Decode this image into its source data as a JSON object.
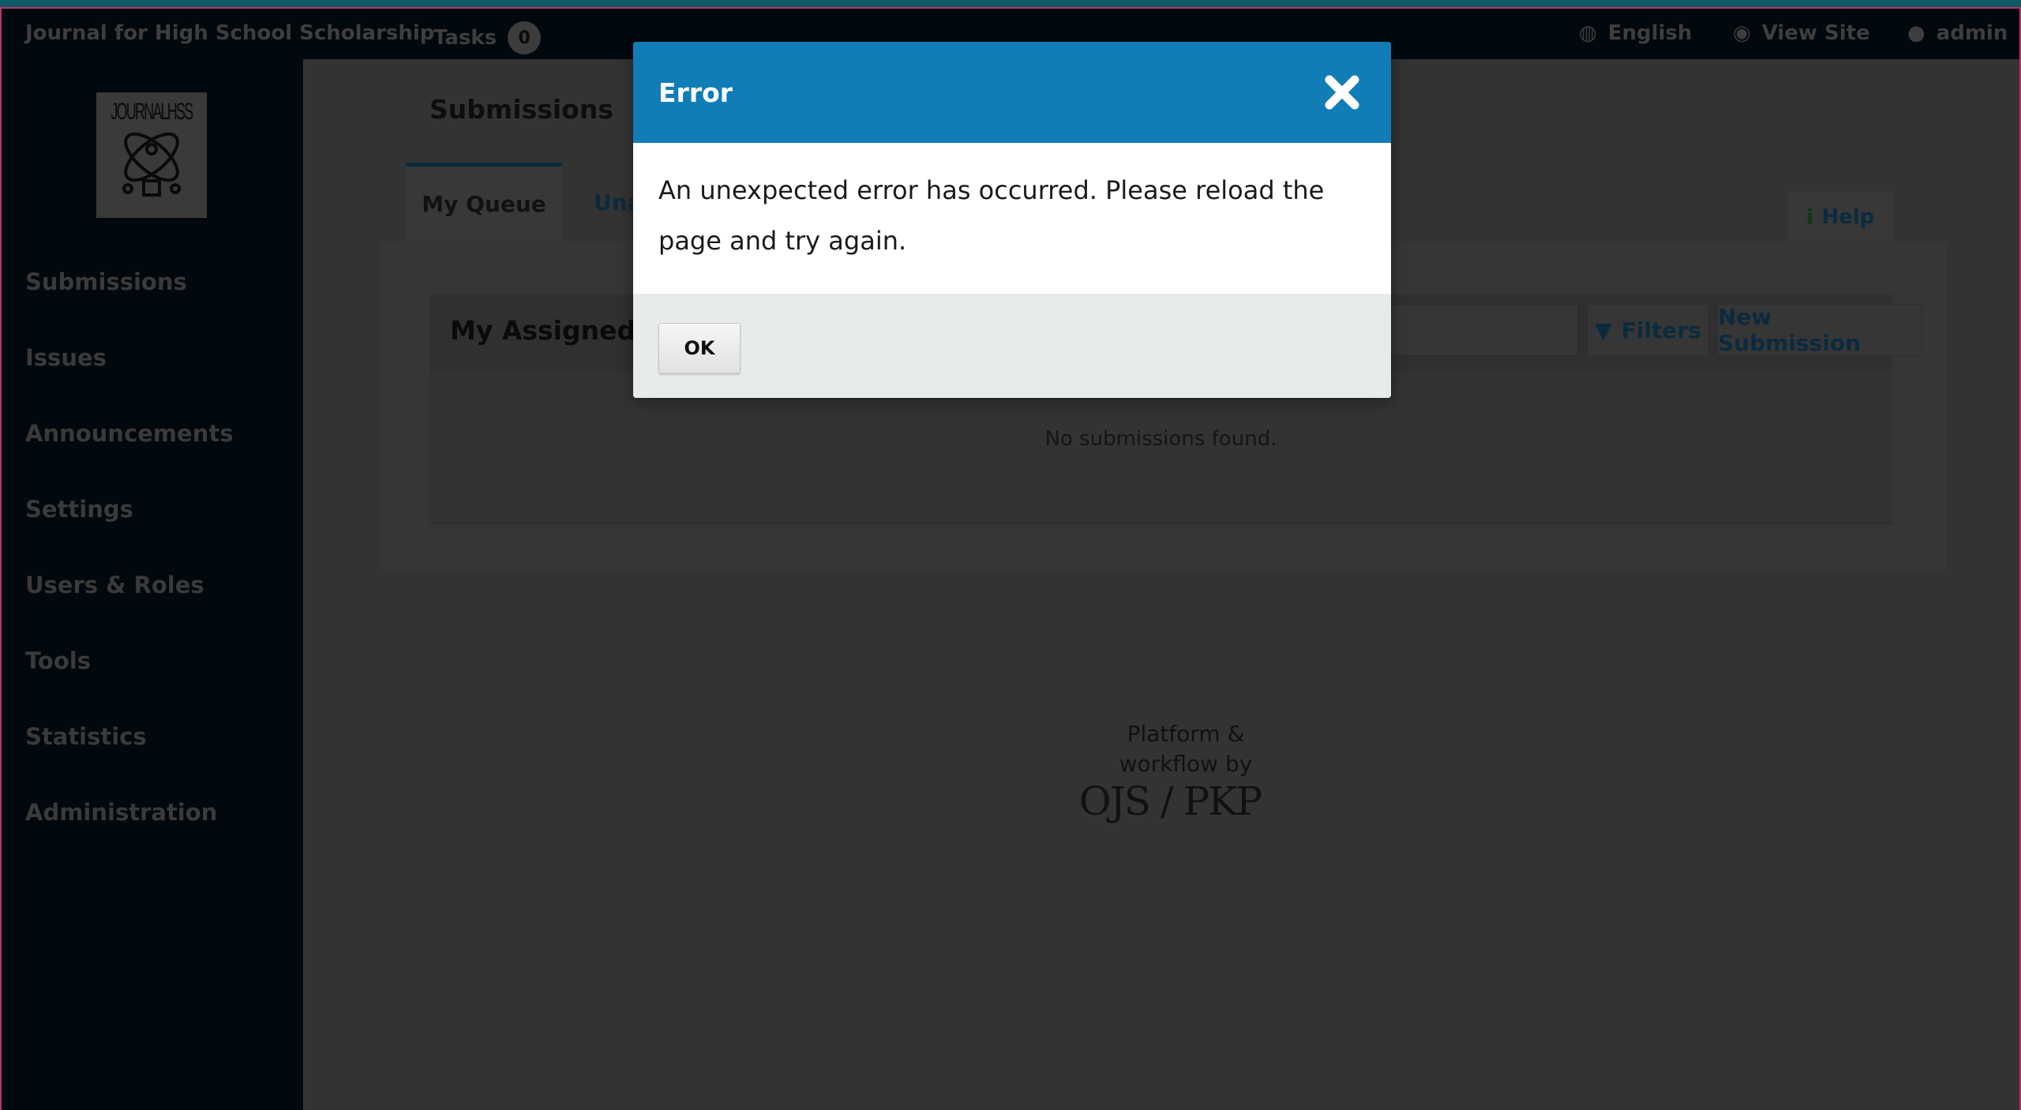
{
  "header": {
    "site_title": "Journal for High School Scholarship",
    "tasks_label": "Tasks",
    "tasks_count": "0",
    "language": "English",
    "view_site": "View Site",
    "user": "admin"
  },
  "logo": {
    "text": "JOURNALHSS"
  },
  "sidebar": {
    "items": [
      {
        "label": "Submissions"
      },
      {
        "label": "Issues"
      },
      {
        "label": "Announcements"
      },
      {
        "label": "Settings"
      },
      {
        "label": "Users & Roles"
      },
      {
        "label": "Tools"
      },
      {
        "label": "Statistics"
      },
      {
        "label": "Administration"
      }
    ]
  },
  "main": {
    "title": "Submissions",
    "tabs": [
      {
        "label": "My Queue"
      },
      {
        "label": "Una"
      }
    ],
    "help": "Help",
    "list": {
      "title": "My Assigned",
      "filters": "Filters",
      "new_submission": "New Submission",
      "empty": "No submissions found."
    }
  },
  "footer": {
    "line1": "Platform &",
    "line2": "workflow by",
    "brand": "OJS / PKP"
  },
  "modal": {
    "title": "Error",
    "message": "An unexpected error has occurred. Please reload the page and try again.",
    "ok": "OK"
  },
  "colors": {
    "modal_header": "#117db7",
    "sidebar": "#01080e",
    "accent_border": "#b8326e"
  }
}
